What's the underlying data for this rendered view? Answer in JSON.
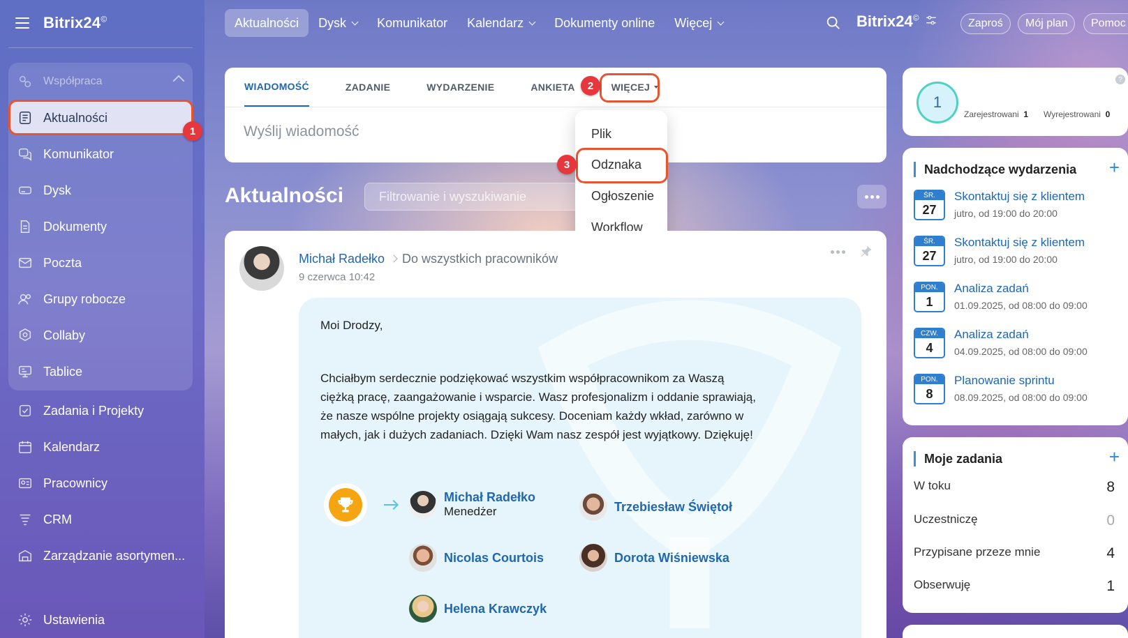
{
  "app": {
    "brand": "Bitrix24",
    "brand_mark": "©"
  },
  "topnav": {
    "items": [
      {
        "label": "Aktualności",
        "active": true,
        "dropdown": false
      },
      {
        "label": "Dysk",
        "active": false,
        "dropdown": true
      },
      {
        "label": "Komunikator",
        "active": false,
        "dropdown": false
      },
      {
        "label": "Kalendarz",
        "active": false,
        "dropdown": true
      },
      {
        "label": "Dokumenty online",
        "active": false,
        "dropdown": false
      },
      {
        "label": "Więcej",
        "active": false,
        "dropdown": true
      }
    ],
    "brand": "Bitrix24",
    "brand_mark": "©",
    "invite": "Zaproś",
    "plan": "Mój plan",
    "help": "Pomoc"
  },
  "sidebar": {
    "group_label": "Współpraca",
    "items": [
      {
        "label": "Aktualności",
        "icon": "feed-icon",
        "active": true
      },
      {
        "label": "Komunikator",
        "icon": "chat-icon"
      },
      {
        "label": "Dysk",
        "icon": "drive-icon"
      },
      {
        "label": "Dokumenty",
        "icon": "document-icon"
      },
      {
        "label": "Poczta",
        "icon": "mail-icon"
      },
      {
        "label": "Grupy robocze",
        "icon": "groups-icon"
      },
      {
        "label": "Collaby",
        "icon": "collab-icon"
      },
      {
        "label": "Tablice",
        "icon": "board-icon"
      },
      {
        "label": "Zadania i Projekty",
        "icon": "tasks-icon"
      },
      {
        "label": "Kalendarz",
        "icon": "calendar-icon"
      },
      {
        "label": "Pracownicy",
        "icon": "employees-icon"
      },
      {
        "label": "CRM",
        "icon": "crm-icon"
      },
      {
        "label": "Zarządzanie asortymen...",
        "icon": "inventory-icon"
      },
      {
        "label": "Ustawienia",
        "icon": "settings-icon"
      }
    ]
  },
  "callouts": {
    "one": "1",
    "two": "2",
    "three": "3"
  },
  "composer": {
    "tabs": [
      "WIADOMOŚĆ",
      "ZADANIE",
      "WYDARZENIE",
      "ANKIETA"
    ],
    "more_label": "WIĘCEJ",
    "placeholder": "Wyślij wiadomość",
    "more_menu": [
      "Plik",
      "Odznaka",
      "Ogłoszenie",
      "Workflow"
    ]
  },
  "feed": {
    "title": "Aktualności",
    "filter_placeholder": "Filtrowanie i wyszukiwanie"
  },
  "post": {
    "author": "Michał Radełko",
    "audience": "Do wszystkich pracowników",
    "date": "9 czerwca 10:42",
    "greeting": "Moi Drodzy,",
    "body": "Chciałbym serdecznie podziękować wszystkim współpracownikom za Waszą ciężką pracę, zaangażowanie i wsparcie. Wasz profesjonalizm i oddanie sprawiają, że nasze wspólne projekty osiągają sukcesy. Doceniam każdy wkład, zarówno w małych, jak i dużych zadaniach. Dzięki Wam nasz zespół jest wyjątkowy. Dziękuję!",
    "badge_icon": "trophy-icon",
    "recipients": [
      {
        "name": "Michał Radełko",
        "role": "Menedżer"
      },
      {
        "name": "Trzebiesław Świętoł",
        "role": ""
      },
      {
        "name": "Nicolas Courtois",
        "role": ""
      },
      {
        "name": "Dorota Wiśniewska",
        "role": ""
      },
      {
        "name": "Helena Krawczyk",
        "role": ""
      }
    ]
  },
  "pulse": {
    "value": "1",
    "registered_label": "Zarejestrowani",
    "registered_count": "1",
    "unregistered_label": "Wyrejestrowani",
    "unregistered_count": "0"
  },
  "events": {
    "title": "Nadchodzące wydarzenia",
    "items": [
      {
        "day": "ŚR.",
        "date": "27",
        "title": "Skontaktuj się z klientem",
        "time": "jutro, od 19:00 do 20:00"
      },
      {
        "day": "ŚR.",
        "date": "27",
        "title": "Skontaktuj się z klientem",
        "time": "jutro, od 19:00 do 20:00"
      },
      {
        "day": "PON.",
        "date": "1",
        "title": "Analiza zadań",
        "time": "01.09.2025, od 08:00 do 09:00"
      },
      {
        "day": "CZW.",
        "date": "4",
        "title": "Analiza zadań",
        "time": "04.09.2025, od 08:00 do 09:00"
      },
      {
        "day": "PON.",
        "date": "8",
        "title": "Planowanie sprintu",
        "time": "08.09.2025, od 08:00 do 09:00"
      }
    ]
  },
  "tasks": {
    "title": "Moje zadania",
    "items": [
      {
        "label": "W toku",
        "count": "8"
      },
      {
        "label": "Uczestniczę",
        "count": "0"
      },
      {
        "label": "Przypisane przeze mnie",
        "count": "4"
      },
      {
        "label": "Obserwuję",
        "count": "1"
      }
    ]
  },
  "colors": {
    "accent": "#2067b0",
    "highlight_outline": "#e8542f",
    "callout": "#e5373c",
    "trophy": "#f5a511"
  }
}
